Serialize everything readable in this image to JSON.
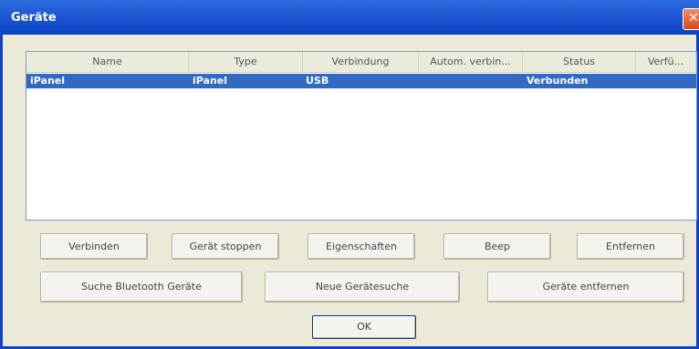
{
  "window": {
    "title": "Geräte",
    "close": "✕"
  },
  "list": {
    "columns": [
      "Name",
      "Type",
      "Verbindung",
      "Autom. verbin...",
      "Status",
      "Verfü..."
    ],
    "rows": [
      {
        "name": "iPanel",
        "type": "iPanel",
        "connection": "USB",
        "auto": "",
        "status": "Verbunden",
        "avail": ""
      }
    ]
  },
  "buttons": {
    "connect": "Verbinden",
    "stop": "Gerät stoppen",
    "properties": "Eigenschaften",
    "beep": "Beep",
    "remove": "Entfernen",
    "search_bt": "Suche Bluetooth Geräte",
    "new_search": "Neue Gerätesuche",
    "remove_devices": "Geräte entfernen",
    "ok": "OK"
  }
}
